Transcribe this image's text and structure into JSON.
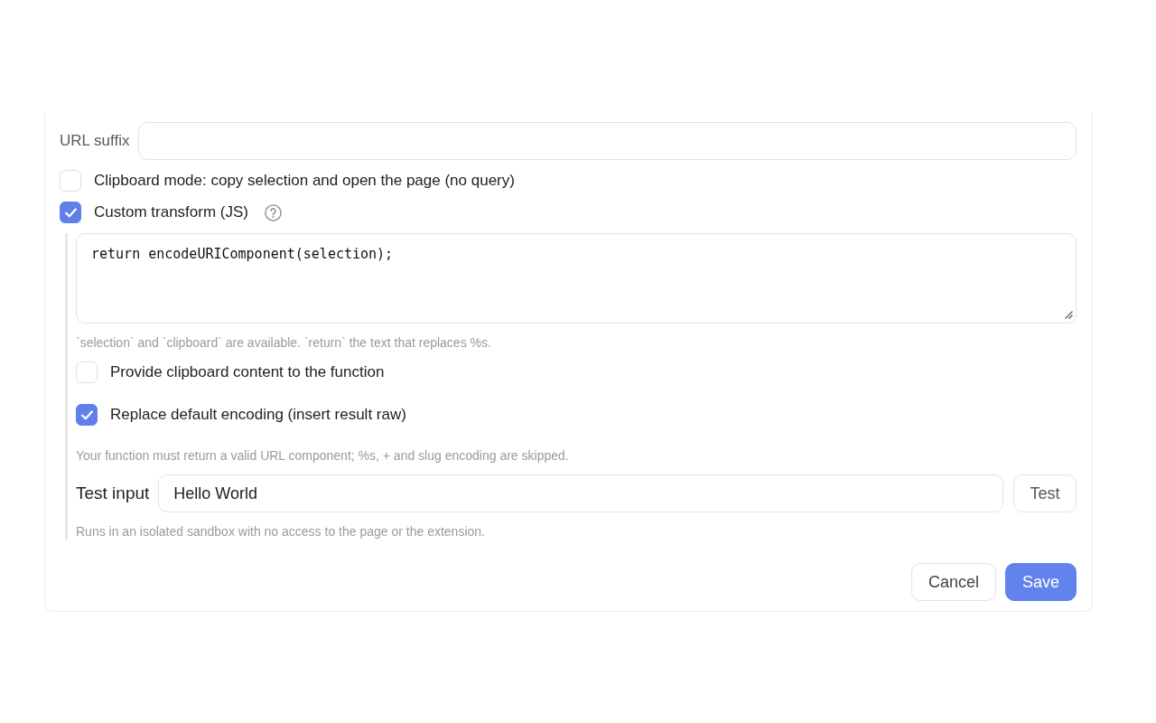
{
  "url_suffix": {
    "label": "URL suffix"
  },
  "clipboard_mode": {
    "label": "Clipboard mode: copy selection and open the page (no query)",
    "checked": false
  },
  "custom_transform": {
    "label": "Custom transform (JS)",
    "checked": true,
    "code": "return encodeURIComponent(selection);",
    "code_hint": "`selection` and `clipboard` are available. `return` the text that replaces %s.",
    "options": [
      {
        "label": "Provide clipboard content to the function",
        "checked": false
      },
      {
        "label": "Replace default encoding (insert result raw)",
        "checked": true
      }
    ],
    "encoding_hint": "Your function must return a valid URL component; %s, + and slug encoding are skipped.",
    "test": {
      "label": "Test input",
      "value": "Hello World",
      "button": "Test"
    },
    "sandbox_hint": "Runs in an isolated sandbox with no access to the page or the extension."
  },
  "buttons": [
    {
      "label": "Cancel",
      "kind": "secondary"
    },
    {
      "label": "Save",
      "kind": "primary"
    }
  ]
}
